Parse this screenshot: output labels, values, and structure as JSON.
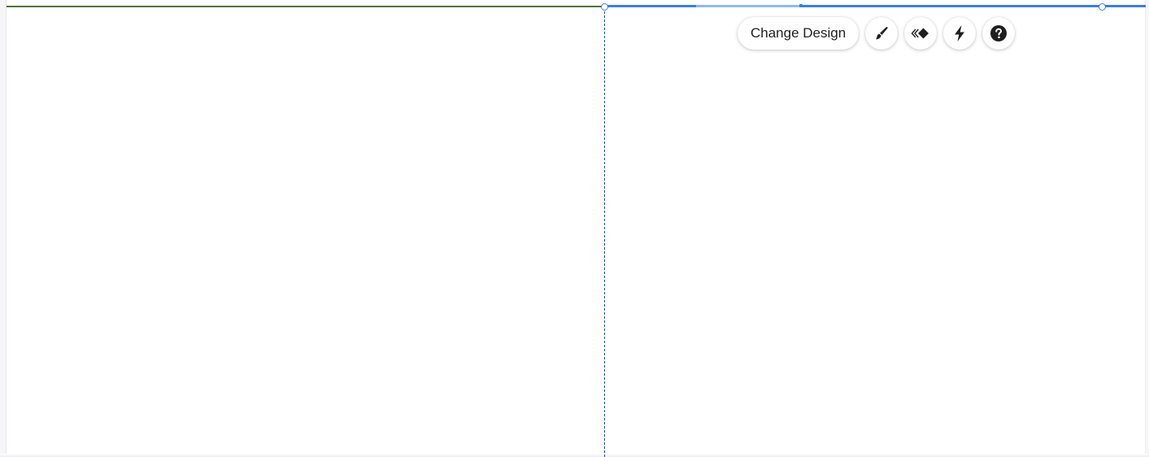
{
  "toolbar": {
    "change_design_label": "Change Design",
    "buttons": [
      {
        "icon": "brush-icon"
      },
      {
        "icon": "animation-icon"
      },
      {
        "icon": "lightning-icon"
      },
      {
        "icon": "help-icon"
      }
    ]
  },
  "colors": {
    "selection_blue": "#3b7ee0",
    "divider_blue": "#1d4fa8",
    "top_border_green": "#4f6f3b",
    "icon_dark": "#1f1f1f"
  }
}
